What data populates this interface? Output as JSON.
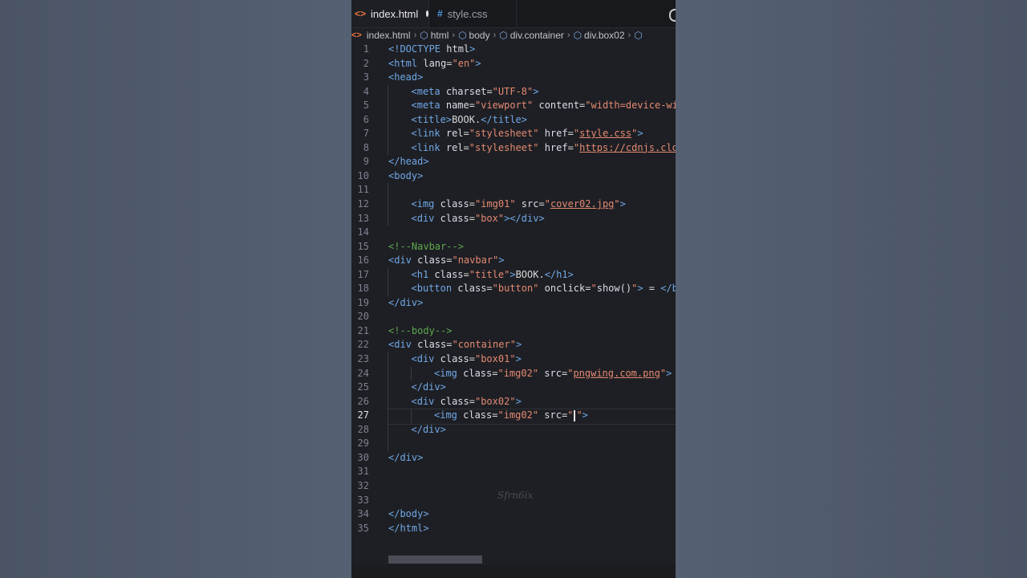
{
  "tabs": [
    {
      "label": "index.html",
      "icon": "html-icon",
      "modified": true
    },
    {
      "label": "style.css",
      "icon": "css-icon"
    }
  ],
  "breadcrumb": [
    "index.html",
    "html",
    "body",
    "div.container",
    "div.box02"
  ],
  "current_line": 27,
  "watermark": "Sfrn6ix",
  "colors": {
    "tag": "#6fa8e6",
    "attr": "#d8dee9",
    "string": "#e48a72",
    "comment": "#5ea84f",
    "editor_bg": "#1e1f24"
  },
  "code": [
    {
      "n": "1",
      "indent": 0,
      "tokens": [
        [
          "tag",
          "<!DOCTYPE "
        ],
        [
          "attr",
          "html"
        ],
        [
          "tag",
          ">"
        ]
      ]
    },
    {
      "n": "2",
      "indent": 0,
      "tokens": [
        [
          "tag",
          "<html "
        ],
        [
          "attr",
          "lang"
        ],
        [
          "eq",
          "="
        ],
        [
          "val",
          "\"en\""
        ],
        [
          "tag",
          ">"
        ]
      ]
    },
    {
      "n": "3",
      "indent": 0,
      "tokens": [
        [
          "tag",
          "<head>"
        ]
      ]
    },
    {
      "n": "4",
      "indent": 1,
      "tokens": [
        [
          "tag",
          "<meta "
        ],
        [
          "attr",
          "charset"
        ],
        [
          "eq",
          "="
        ],
        [
          "val",
          "\"UTF-8\""
        ],
        [
          "tag",
          ">"
        ]
      ]
    },
    {
      "n": "5",
      "indent": 1,
      "tokens": [
        [
          "tag",
          "<meta "
        ],
        [
          "attr",
          "name"
        ],
        [
          "eq",
          "="
        ],
        [
          "val",
          "\"viewport\""
        ],
        [
          "attr",
          " content"
        ],
        [
          "eq",
          "="
        ],
        [
          "val",
          "\"width=device-wid"
        ]
      ]
    },
    {
      "n": "6",
      "indent": 1,
      "tokens": [
        [
          "tag",
          "<title>"
        ],
        [
          "text",
          "BOOK."
        ],
        [
          "tag",
          "</title>"
        ]
      ]
    },
    {
      "n": "7",
      "indent": 1,
      "tokens": [
        [
          "tag",
          "<link "
        ],
        [
          "attr",
          "rel"
        ],
        [
          "eq",
          "="
        ],
        [
          "val",
          "\"stylesheet\""
        ],
        [
          "attr",
          " href"
        ],
        [
          "eq",
          "="
        ],
        [
          "val",
          "\""
        ],
        [
          "link",
          "style.css"
        ],
        [
          "val",
          "\""
        ],
        [
          "tag",
          ">"
        ]
      ]
    },
    {
      "n": "8",
      "indent": 1,
      "tokens": [
        [
          "tag",
          "<link "
        ],
        [
          "attr",
          "rel"
        ],
        [
          "eq",
          "="
        ],
        [
          "val",
          "\"stylesheet\""
        ],
        [
          "attr",
          " href"
        ],
        [
          "eq",
          "="
        ],
        [
          "val",
          "\""
        ],
        [
          "link",
          "https://cdnjs.clou"
        ]
      ]
    },
    {
      "n": "9",
      "indent": 0,
      "tokens": [
        [
          "tag",
          "</head>"
        ]
      ]
    },
    {
      "n": "10",
      "indent": 0,
      "tokens": [
        [
          "tag",
          "<body>"
        ]
      ]
    },
    {
      "n": "11",
      "indent": 1,
      "tokens": []
    },
    {
      "n": "12",
      "indent": 1,
      "tokens": [
        [
          "tag",
          "<img "
        ],
        [
          "attr",
          "class"
        ],
        [
          "eq",
          "="
        ],
        [
          "val",
          "\"img01\""
        ],
        [
          "attr",
          " src"
        ],
        [
          "eq",
          "="
        ],
        [
          "val",
          "\""
        ],
        [
          "link",
          "cover02.jpg"
        ],
        [
          "val",
          "\""
        ],
        [
          "tag",
          ">"
        ]
      ]
    },
    {
      "n": "13",
      "indent": 1,
      "tokens": [
        [
          "tag",
          "<div "
        ],
        [
          "attr",
          "class"
        ],
        [
          "eq",
          "="
        ],
        [
          "val",
          "\"box\""
        ],
        [
          "tag",
          "></div>"
        ]
      ]
    },
    {
      "n": "14",
      "indent": 0,
      "tokens": []
    },
    {
      "n": "15",
      "indent": 0,
      "tokens": [
        [
          "comment",
          "<!--Navbar-->"
        ]
      ]
    },
    {
      "n": "16",
      "indent": 0,
      "tokens": [
        [
          "tag",
          "<div "
        ],
        [
          "attr",
          "class"
        ],
        [
          "eq",
          "="
        ],
        [
          "val",
          "\"navbar\""
        ],
        [
          "tag",
          ">"
        ]
      ]
    },
    {
      "n": "17",
      "indent": 1,
      "tokens": [
        [
          "tag",
          "<h1 "
        ],
        [
          "attr",
          "class"
        ],
        [
          "eq",
          "="
        ],
        [
          "val",
          "\"title\""
        ],
        [
          "tag",
          ">"
        ],
        [
          "text",
          "BOOK."
        ],
        [
          "tag",
          "</h1>"
        ]
      ]
    },
    {
      "n": "18",
      "indent": 1,
      "tokens": [
        [
          "tag",
          "<button "
        ],
        [
          "attr",
          "class"
        ],
        [
          "eq",
          "="
        ],
        [
          "val",
          "\"button\""
        ],
        [
          "attr",
          " onclick"
        ],
        [
          "eq",
          "="
        ],
        [
          "val",
          "\""
        ],
        [
          "attr",
          "show()"
        ],
        [
          "val",
          "\""
        ],
        [
          "tag",
          ">"
        ],
        [
          "text",
          " = "
        ],
        [
          "tag",
          "</bu"
        ]
      ]
    },
    {
      "n": "19",
      "indent": 0,
      "tokens": [
        [
          "tag",
          "</div>"
        ]
      ]
    },
    {
      "n": "20",
      "indent": 0,
      "tokens": []
    },
    {
      "n": "21",
      "indent": 0,
      "tokens": [
        [
          "comment",
          "<!--body-->"
        ]
      ]
    },
    {
      "n": "22",
      "indent": 0,
      "tokens": [
        [
          "tag",
          "<div "
        ],
        [
          "attr",
          "class"
        ],
        [
          "eq",
          "="
        ],
        [
          "val",
          "\"container\""
        ],
        [
          "tag",
          ">"
        ]
      ]
    },
    {
      "n": "23",
      "indent": 1,
      "tokens": [
        [
          "tag",
          "<div "
        ],
        [
          "attr",
          "class"
        ],
        [
          "eq",
          "="
        ],
        [
          "val",
          "\"box01\""
        ],
        [
          "tag",
          ">"
        ]
      ]
    },
    {
      "n": "24",
      "indent": 2,
      "tokens": [
        [
          "tag",
          "<img "
        ],
        [
          "attr",
          "class"
        ],
        [
          "eq",
          "="
        ],
        [
          "val",
          "\"img02\""
        ],
        [
          "attr",
          " src"
        ],
        [
          "eq",
          "="
        ],
        [
          "val",
          "\""
        ],
        [
          "link",
          "pngwing.com.png"
        ],
        [
          "val",
          "\""
        ],
        [
          "tag",
          ">"
        ]
      ]
    },
    {
      "n": "25",
      "indent": 1,
      "tokens": [
        [
          "tag",
          "</div>"
        ]
      ]
    },
    {
      "n": "26",
      "indent": 1,
      "tokens": [
        [
          "tag",
          "<div "
        ],
        [
          "attr",
          "class"
        ],
        [
          "eq",
          "="
        ],
        [
          "val",
          "\"box02\""
        ],
        [
          "tag",
          ">"
        ]
      ]
    },
    {
      "n": "27",
      "indent": 2,
      "tokens": [
        [
          "tag",
          "<img "
        ],
        [
          "attr",
          "class"
        ],
        [
          "eq",
          "="
        ],
        [
          "val",
          "\"img02\""
        ],
        [
          "attr",
          " src"
        ],
        [
          "eq",
          "="
        ],
        [
          "val",
          "\""
        ],
        [
          "caret",
          ""
        ],
        [
          "val",
          "\""
        ],
        [
          "tag",
          ">"
        ]
      ]
    },
    {
      "n": "28",
      "indent": 1,
      "tokens": [
        [
          "tag",
          "</div>"
        ]
      ]
    },
    {
      "n": "29",
      "indent": 1,
      "tokens": []
    },
    {
      "n": "30",
      "indent": 0,
      "tokens": [
        [
          "tag",
          "</div>"
        ]
      ]
    },
    {
      "n": "31",
      "indent": 0,
      "tokens": []
    },
    {
      "n": "32",
      "indent": 0,
      "tokens": []
    },
    {
      "n": "33",
      "indent": 0,
      "tokens": []
    },
    {
      "n": "34",
      "indent": 0,
      "tokens": [
        [
          "tag",
          "</body>"
        ]
      ]
    },
    {
      "n": "35",
      "indent": 0,
      "tokens": [
        [
          "tag",
          "</html>"
        ]
      ]
    }
  ]
}
